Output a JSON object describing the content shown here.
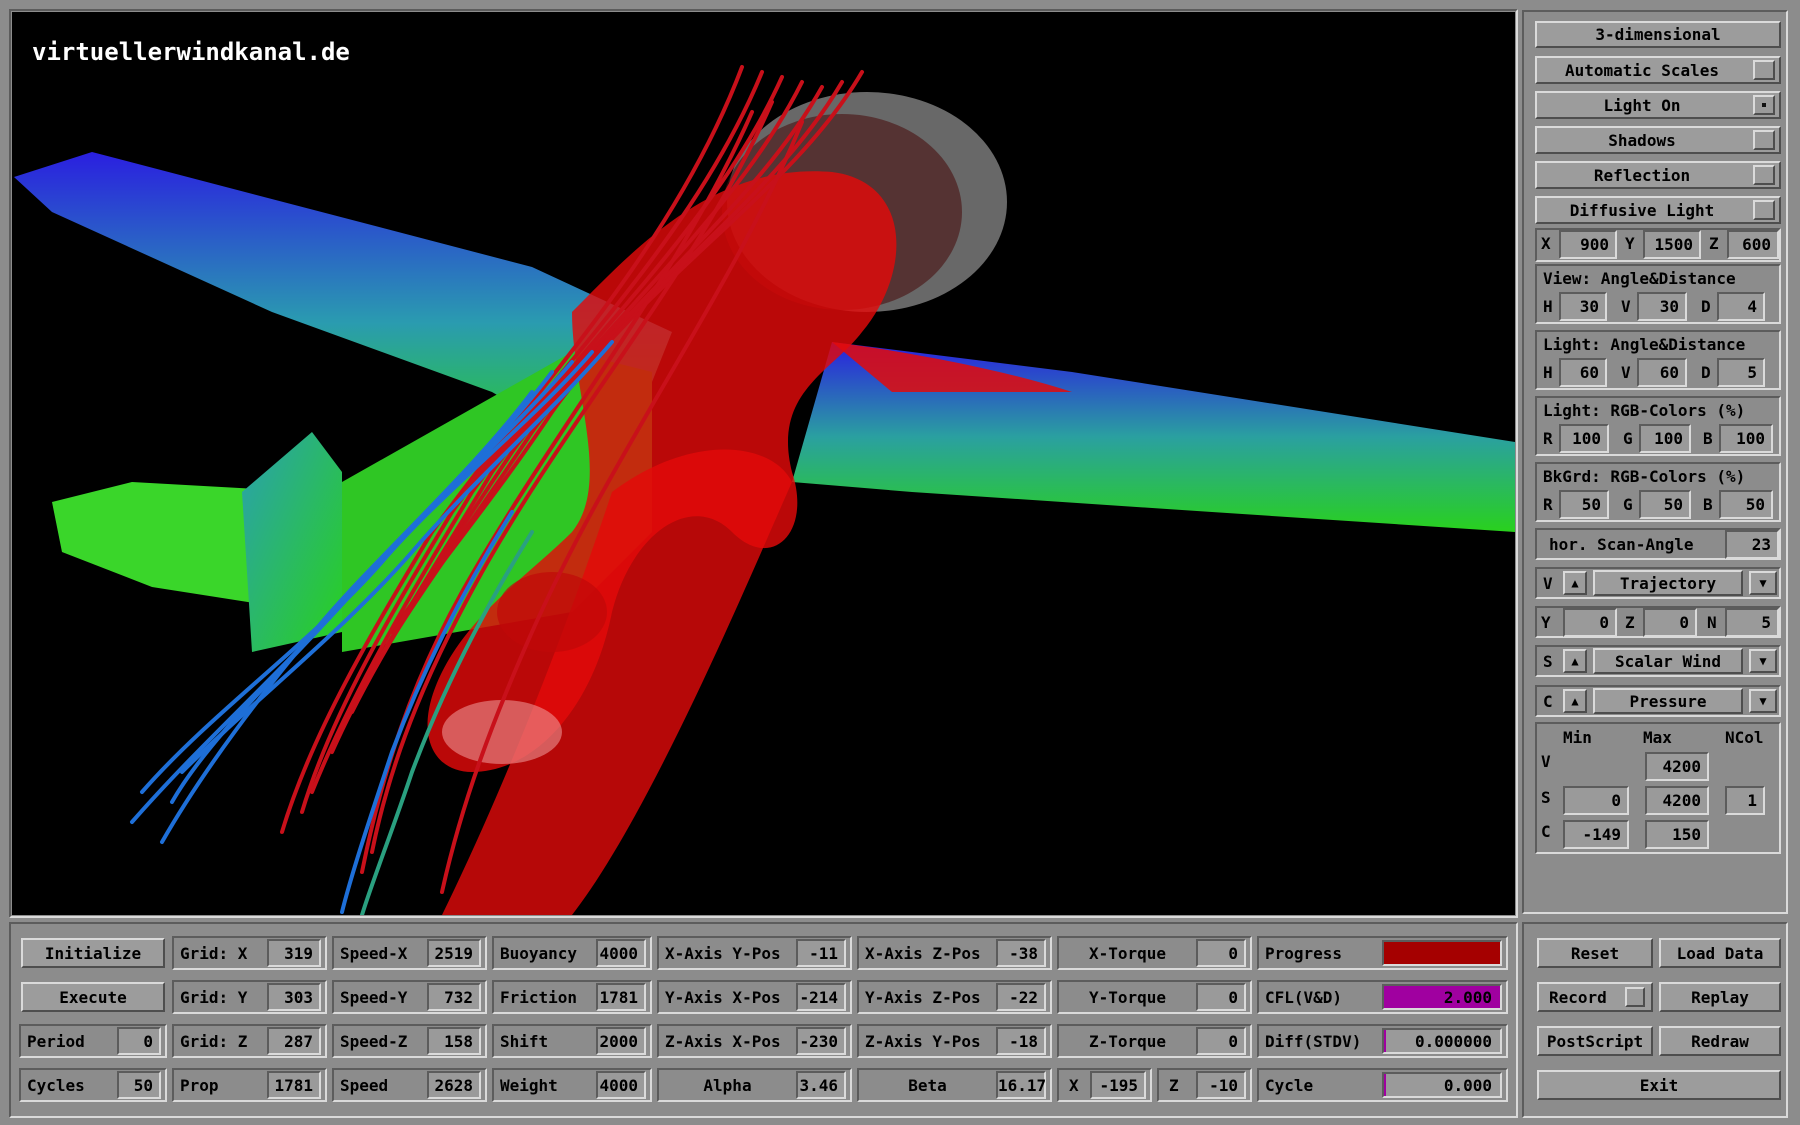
{
  "viewport": {
    "watermark": "virtuellerwindkanal.de",
    "scene_colors": {
      "wing_tip": "#2a1fe0",
      "wing_root": "#29d11d",
      "flow_surface": "#e30a0a",
      "streamline_blue": "#1e6fd8",
      "streamline_red": "#c8101a"
    }
  },
  "right_panel": {
    "mode_button": "3-dimensional",
    "toggles": [
      {
        "label": "Automatic Scales",
        "checked": false
      },
      {
        "label": "Light On",
        "checked": true
      },
      {
        "label": "Shadows",
        "checked": false
      },
      {
        "label": "Reflection",
        "checked": false
      },
      {
        "label": "Diffusive Light",
        "checked": false
      }
    ],
    "position": {
      "x_label": "X",
      "x": "900",
      "y_label": "Y",
      "y": "1500",
      "z_label": "Z",
      "z": "600"
    },
    "view": {
      "title": "View:  Angle&Distance",
      "h_label": "H",
      "h": "30",
      "v_label": "V",
      "v": "30",
      "d_label": "D",
      "d": "4"
    },
    "light": {
      "title": "Light: Angle&Distance",
      "h_label": "H",
      "h": "60",
      "v_label": "V",
      "v": "60",
      "d_label": "D",
      "d": "5"
    },
    "light_rgb": {
      "title": "Light: RGB-Colors (%)",
      "r_label": "R",
      "r": "100",
      "g_label": "G",
      "g": "100",
      "b_label": "B",
      "b": "100"
    },
    "bkgrd_rgb": {
      "title": "BkGrd: RGB-Colors (%)",
      "r_label": "R",
      "r": "50",
      "g_label": "G",
      "g": "50",
      "b_label": "B",
      "b": "50"
    },
    "scan": {
      "label": "hor. Scan-Angle",
      "value": "23"
    },
    "selectors": [
      {
        "key": "V",
        "value": "Trajectory"
      },
      {
        "key": "S",
        "value": "Scalar Wind"
      },
      {
        "key": "C",
        "value": "Pressure"
      }
    ],
    "yzn": {
      "y_label": "Y",
      "y": "0",
      "z_label": "Z",
      "z": "0",
      "n_label": "N",
      "n": "5"
    },
    "scales": {
      "min_header": "Min",
      "max_header": "Max",
      "ncol_header": "NCol",
      "v_label": "V",
      "v_max": "4200",
      "s_label": "S",
      "s_min": "0",
      "s_max": "4200",
      "s_ncol": "1",
      "c_label": "C",
      "c_min": "-149",
      "c_max": "150"
    }
  },
  "bottom_panel": {
    "col1": [
      {
        "type": "button",
        "label": "Initialize"
      },
      {
        "type": "button",
        "label": "Execute"
      },
      {
        "type": "field",
        "label": "Period",
        "value": "0"
      },
      {
        "type": "field",
        "label": "Cycles",
        "value": "50"
      }
    ],
    "col2": [
      {
        "label": "Grid: X",
        "value": "319"
      },
      {
        "label": "Grid: Y",
        "value": "303"
      },
      {
        "label": "Grid: Z",
        "value": "287"
      },
      {
        "label": "Prop",
        "value": "1781"
      }
    ],
    "col3": [
      {
        "label": "Speed-X",
        "value": "2519"
      },
      {
        "label": "Speed-Y",
        "value": "732"
      },
      {
        "label": "Speed-Z",
        "value": "158"
      },
      {
        "label": "Speed",
        "value": "2628"
      }
    ],
    "col4": [
      {
        "label": "Buoyancy",
        "value": "4000"
      },
      {
        "label": "Friction",
        "value": "1781"
      },
      {
        "label": "Shift",
        "value": "2000"
      },
      {
        "label": "Weight",
        "value": "4000"
      }
    ],
    "col5": [
      {
        "label": "X-Axis Y-Pos",
        "value": "-11"
      },
      {
        "label": "Y-Axis X-Pos",
        "value": "-214"
      },
      {
        "label": "Z-Axis X-Pos",
        "value": "-230"
      },
      {
        "label": "Alpha",
        "value": "3.46"
      }
    ],
    "col6": [
      {
        "label": "X-Axis Z-Pos",
        "value": "-38"
      },
      {
        "label": "Y-Axis Z-Pos",
        "value": "-22"
      },
      {
        "label": "Z-Axis Y-Pos",
        "value": "-18"
      },
      {
        "label": "Beta",
        "value": "16.17"
      }
    ],
    "col7": [
      {
        "label": "X-Torque",
        "value": "0"
      },
      {
        "label": "Y-Torque",
        "value": "0"
      },
      {
        "label": "Z-Torque",
        "value": "0"
      }
    ],
    "col7_xz": {
      "x_label": "X",
      "x": "-195",
      "z_label": "Z",
      "z": "-10"
    },
    "col8": [
      {
        "label": "Progress",
        "value": "",
        "fill_color": "#a50000",
        "fill": 1.0
      },
      {
        "label": "CFL(V&D)",
        "value": "2.000",
        "fill_color": "#a000a0",
        "fill": 1.0
      },
      {
        "label": "Diff(STDV)",
        "value": "0.000000",
        "fill_color": "#a000a0",
        "fill": 0.0
      },
      {
        "label": "Cycle",
        "value": "0.000",
        "fill_color": "#a000a0",
        "fill": 0.0
      }
    ],
    "actions": [
      {
        "label": "Reset"
      },
      {
        "label": "Load Data"
      },
      {
        "label": "Record"
      },
      {
        "label": "Replay"
      },
      {
        "label": "PostScript"
      },
      {
        "label": "Redraw"
      },
      {
        "label": "Exit"
      }
    ]
  }
}
